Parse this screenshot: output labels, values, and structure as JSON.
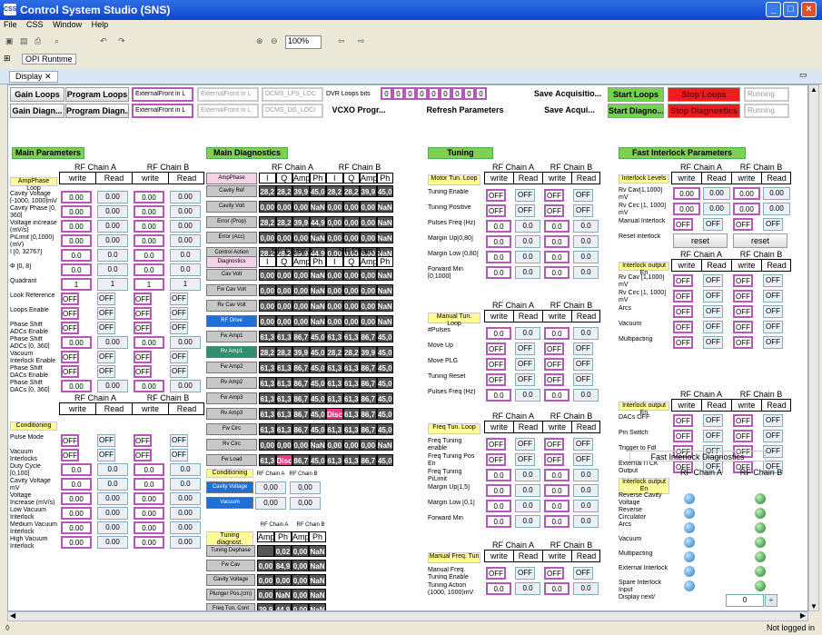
{
  "window": {
    "title": "Control System Studio (SNS)"
  },
  "menu": [
    "File",
    "CSS",
    "Window",
    "Help"
  ],
  "toolbar": {
    "zoom": "100%"
  },
  "perspective": "OPI Runtime",
  "view_tab": "Display",
  "top": {
    "row1": {
      "gain_loops": "Gain Loops",
      "program_loops": "Program Loops",
      "combo1": "ExternalFront in L",
      "combo2": "ExternalFront in L",
      "combo3": "DCMS_LPS_LOC",
      "dvr_label": "DVR Loops bits",
      "bits": [
        "0",
        "0",
        "0",
        "0",
        "0",
        "0",
        "0",
        "0",
        "0"
      ],
      "save": "Save Acquisitio...",
      "start": "Start Loops",
      "stop": "Stop Loops",
      "running": "Running"
    },
    "row2": {
      "gain_diag": "Gain Diagn...",
      "program_diag": "Program Diagn...",
      "combo1": "ExternalFront in L",
      "combo2": "ExternalFront in L",
      "combo3": "DCMS_DG_LOCI",
      "vcxo": "VCXO Progr...",
      "refresh": "Refresh Parameters",
      "save": "Save Acqui...",
      "start": "Start Diagno...",
      "stop": "Stop Diagnostics",
      "running": "Running"
    }
  },
  "headers": {
    "main": "Main Parameters",
    "diag": "Main Diagnostics",
    "tuning": "Tuning",
    "fil": "Fast Interlock Parameters"
  },
  "common": {
    "chA": "RF Chain A",
    "chB": "RF Chain B",
    "write": "write",
    "read": "Read",
    "off": "OFF",
    "zero": "0.00",
    "z1": "0.0",
    "z0": "0",
    "one": "1",
    "reset": "reset"
  },
  "ampphase": {
    "title": "AmpPhase Loop",
    "rows": [
      "Cavity Voltage [-1000, 1000]mV",
      "Cavity Phase [0, 360]",
      "Voltage increase (mV/s)",
      "PiLimit [0,1000] (mV)",
      "I [0, 32767]",
      "Φ [0, 8]",
      "Quadrant",
      "Look Reference",
      "Loops Enable",
      "Phase Shift ADCs Enable",
      "Phase Shift ADCs [0, 360]",
      "Vacuum Interlock Enable",
      "Phase Shift DACs Enable",
      "Phase Shift DACs [0, 360]"
    ]
  },
  "conditioning": {
    "title": "Conditioning",
    "rows": [
      "Pulse Mode",
      "Vacuum Interlocks",
      "Duty Cycle [0,100]",
      "Cavity Voltage mV",
      "Voltage Increase (mV/s)",
      "Low Vacuum Interlock",
      "Medium Vacuum Interlock",
      "High Vacuum Interlock"
    ]
  },
  "diag": {
    "ap_label": "AmpPhase",
    "cols": [
      "I",
      "Q",
      "Amp",
      "Ph",
      "I",
      "Q",
      "Amp",
      "Ph"
    ],
    "ap_rows": [
      {
        "n": "Cavity Ref",
        "v": [
          "28,2",
          "28,2",
          "39,9",
          "45,0",
          "28,2",
          "28,2",
          "39,9",
          "45,0"
        ]
      },
      {
        "n": "Cavity Volt",
        "v": [
          "0,00",
          "0,00",
          "0,00",
          "NaN",
          "0,00",
          "0,00",
          "0,00",
          "NaN"
        ]
      },
      {
        "n": "Error (Prop)",
        "v": [
          "28,2",
          "28,2",
          "39,9",
          "44,9",
          "0,00",
          "0,00",
          "0,00",
          "NaN"
        ]
      },
      {
        "n": "Error (Acc)",
        "v": [
          "0,00",
          "0,00",
          "0,00",
          "NaN",
          "0,00",
          "0,00",
          "0,00",
          "NaN"
        ]
      },
      {
        "n": "Control Action",
        "v": [
          "28,2",
          "28,2",
          "39,9",
          "44,9",
          "0,00",
          "0,00",
          "0,00",
          "NaN"
        ]
      }
    ],
    "d_label": "Diagnostics",
    "d_rows": [
      {
        "n": "Cav Volt",
        "v": [
          "0,00",
          "0,00",
          "0,00",
          "NaN",
          "0,00",
          "0,00",
          "0,00",
          "NaN"
        ]
      },
      {
        "n": "Fw Cav Volt",
        "v": [
          "0,00",
          "0,00",
          "0,00",
          "NaN",
          "0,00",
          "0,00",
          "0,00",
          "NaN"
        ]
      },
      {
        "n": "Rv Cav Volt",
        "v": [
          "0,00",
          "0,00",
          "0,00",
          "NaN",
          "0,00",
          "0,00",
          "0,00",
          "NaN"
        ]
      },
      {
        "n": "RF Drive",
        "v": [
          "0,00",
          "0,00",
          "0,00",
          "NaN",
          "0,00",
          "0,00",
          "0,00",
          "NaN"
        ]
      },
      {
        "n": "Fw Amp1",
        "v": [
          "61,3",
          "61,3",
          "86,7",
          "45,0",
          "61,3",
          "61,3",
          "86,7",
          "45,0"
        ]
      },
      {
        "n": "Rv Amp1",
        "v": [
          "28,2",
          "28,2",
          "39,9",
          "45,0",
          "28,2",
          "28,2",
          "39,9",
          "45,0"
        ]
      },
      {
        "n": "Fw Amp2",
        "v": [
          "61,3",
          "61,3",
          "86,7",
          "45,0",
          "61,3",
          "61,3",
          "86,7",
          "45,0"
        ]
      },
      {
        "n": "Rv Amp2",
        "v": [
          "61,3",
          "61,3",
          "86,7",
          "45,0",
          "61,3",
          "61,3",
          "86,7",
          "45,0"
        ]
      },
      {
        "n": "Fw Amp3",
        "v": [
          "61,3",
          "61,3",
          "86,7",
          "45,0",
          "61,3",
          "61,3",
          "86,7",
          "45,0"
        ]
      },
      {
        "n": "Rv Amp3",
        "v": [
          "61,3",
          "61,3",
          "86,7",
          "45,0",
          "Disc",
          "61,3",
          "86,7",
          "45,0"
        ]
      },
      {
        "n": "Fw Circ",
        "v": [
          "61,3",
          "61,3",
          "86,7",
          "45,0",
          "61,3",
          "61,3",
          "86,7",
          "45,0"
        ]
      },
      {
        "n": "Rv Circ",
        "v": [
          "0,00",
          "0,00",
          "0,00",
          "NaN",
          "0,00",
          "0,00",
          "0,00",
          "NaN"
        ]
      },
      {
        "n": "Fw Load",
        "v": [
          "61,3",
          "Disc",
          "86,7",
          "45,0",
          "61,3",
          "61,3",
          "86,7",
          "45,0"
        ]
      }
    ],
    "cond_label": "Conditioning",
    "cond_rows": [
      {
        "n": "Cavity Voltage",
        "a": "0,00",
        "b": "0,00"
      },
      {
        "n": "Vacuum",
        "a": "0,00",
        "b": "0,00"
      }
    ],
    "td_label": "Tuning diagnost.",
    "td_cols": [
      "Amp",
      "Ph",
      "Amp",
      "Ph"
    ],
    "td_rows": [
      {
        "n": "Tuning Dephase",
        "v": [
          "",
          "0,02",
          "0,00",
          "NaN"
        ]
      },
      {
        "n": "Fw Cav",
        "v": [
          "0,00",
          "84,9",
          "0,00",
          "NaN"
        ]
      },
      {
        "n": "Cavity Voltage",
        "v": [
          "0,00",
          "0,00",
          "0,00",
          "NaN"
        ]
      },
      {
        "n": "Plunger Pos.(cm)",
        "v": [
          "0,00",
          "NaN",
          "0,00",
          "NaN"
        ]
      },
      {
        "n": "Freq Tun. Cont",
        "v": [
          "39,9",
          "44,9",
          "0,00",
          "NaN"
        ]
      }
    ]
  },
  "tuning": {
    "motor": "Motor Tun. Loop",
    "motor_rows": [
      "Tuning Enable",
      "Tuning Positive",
      "Pulses Freq (Hz)",
      "Margin Up[0,80]",
      "Margin Low [0,80]",
      "Forward Min [0,1000]"
    ],
    "manual": "Manual Tun. Loop",
    "manual_rows": [
      "#Pulses",
      "Move Up",
      "Move PLG",
      "Tuning Reset",
      "Pulses Freq (Hz)"
    ],
    "freq": "Freq Tun. Loop",
    "freq_rows": [
      "Freq Tuning enable",
      "Freq Tuning Pos En",
      "Freq Tuning PiLimit",
      "Margin Up[1,5]",
      "Margin Low [0,1]",
      "Forward Min"
    ],
    "mfreq": "Manual Freq. Tun",
    "mfreq_rows": [
      "Manual Freq. Tuning Enable",
      "Tuning Action (1000, 1000)mV"
    ]
  },
  "fil": {
    "levels": "Interlock Levels",
    "level_rows": [
      "Rv Cav[1,1000] mV",
      "Rv Circ [1, 1000] mV",
      "Manual Interlock",
      "Reset interlock"
    ],
    "out": "Interlock output En",
    "out_rows": [
      "Rv Cav [1,1000] mV",
      "Rv Circ [1, 1000] mV",
      "Arcs",
      "Vacuum",
      "Multipacting"
    ],
    "out2": "Interlock output En",
    "out2_rows": [
      "DACs OFF",
      "Pin Switch",
      "Trigger to Fdl",
      "External ITCK Output"
    ],
    "diag_title": "Fast Interlock Diagnostics",
    "idiag": "Interlock output En",
    "idiag_rows": [
      "Reverse Cavity Voltage",
      "Reverse Circulator",
      "Arcs",
      "Vacuum",
      "Multipacting",
      "External Interlock",
      "Spare Interlock Input",
      "Display next/"
    ],
    "spinner": "0"
  },
  "status": "Not logged in"
}
